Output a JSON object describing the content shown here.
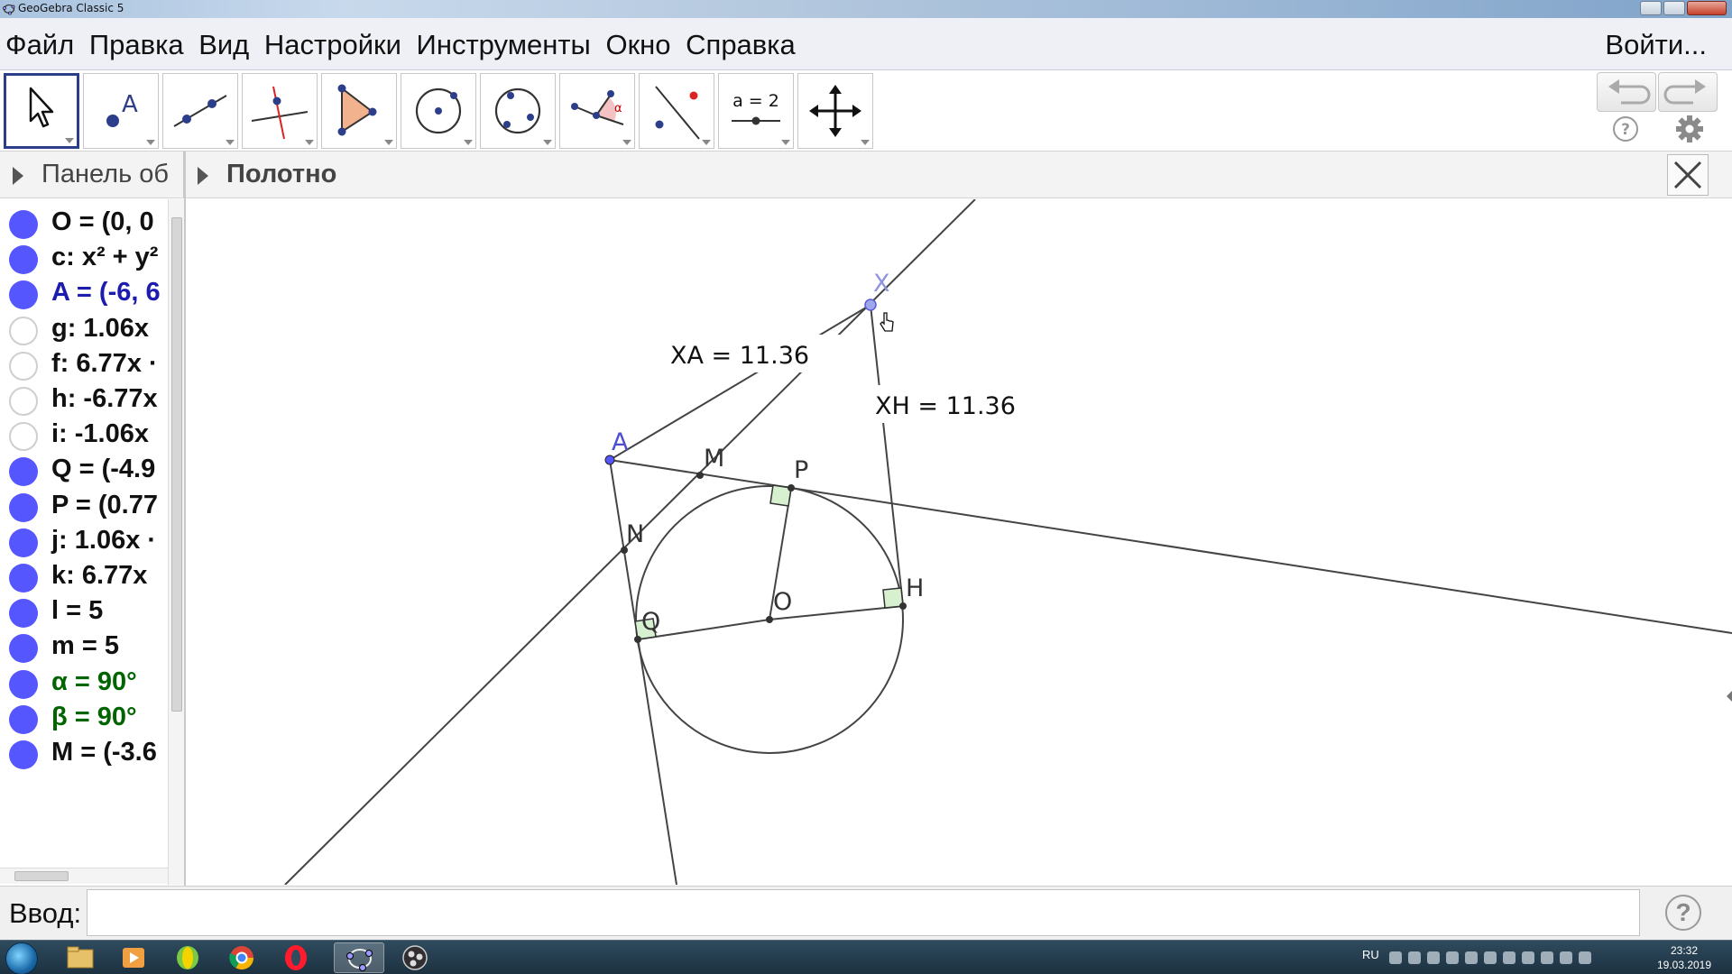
{
  "window": {
    "title": "GeoGebra Classic 5"
  },
  "menu": {
    "items": [
      {
        "label": "Файл"
      },
      {
        "label": "Правка"
      },
      {
        "label": "Вид"
      },
      {
        "label": "Настройки"
      },
      {
        "label": "Инструменты"
      },
      {
        "label": "Окно"
      },
      {
        "label": "Справка"
      }
    ],
    "login": "Войти..."
  },
  "toolbar": {
    "tools": [
      {
        "name": "move-tool"
      },
      {
        "name": "point-tool",
        "glyph": "A"
      },
      {
        "name": "line-tool"
      },
      {
        "name": "perpendicular-line-tool"
      },
      {
        "name": "polygon-tool"
      },
      {
        "name": "circle-center-point-tool"
      },
      {
        "name": "circle-three-points-tool"
      },
      {
        "name": "angle-tool",
        "glyph": "α"
      },
      {
        "name": "reflect-tool"
      },
      {
        "name": "slider-tool",
        "glyph": "a = 2"
      },
      {
        "name": "move-graphics-view-tool"
      }
    ],
    "undo": "undo-icon",
    "redo": "redo-icon",
    "help": "help-icon",
    "settings": "gear-icon"
  },
  "panels": {
    "algebra_title": "Панель об",
    "graphics_title": "Полотно"
  },
  "algebra": {
    "items": [
      {
        "text": "O = (0, 0",
        "visible": true,
        "color": "#111111"
      },
      {
        "text": "c: x² + y²",
        "visible": true,
        "color": "#111111"
      },
      {
        "text": "A = (-6, 6",
        "visible": true,
        "color": "#1c1cae"
      },
      {
        "text": "g: 1.06x",
        "visible": false,
        "color": "#111111"
      },
      {
        "text": "f: 6.77x ·",
        "visible": false,
        "color": "#111111"
      },
      {
        "text": "h: -6.77x",
        "visible": false,
        "color": "#111111"
      },
      {
        "text": "i: -1.06x",
        "visible": false,
        "color": "#111111"
      },
      {
        "text": "Q = (-4.9",
        "visible": true,
        "color": "#111111"
      },
      {
        "text": "P = (0.77",
        "visible": true,
        "color": "#111111"
      },
      {
        "text": "j: 1.06x ·",
        "visible": true,
        "color": "#111111"
      },
      {
        "text": "k: 6.77x",
        "visible": true,
        "color": "#111111"
      },
      {
        "text": "l = 5",
        "visible": true,
        "color": "#111111"
      },
      {
        "text": "m = 5",
        "visible": true,
        "color": "#111111"
      },
      {
        "text": "α = 90°",
        "visible": true,
        "color": "#006400"
      },
      {
        "text": "β = 90°",
        "visible": true,
        "color": "#006400"
      },
      {
        "text": "M = (-3.6",
        "visible": true,
        "color": "#111111"
      }
    ]
  },
  "graphics": {
    "point_labels": {
      "X": "X",
      "A": "A",
      "M": "M",
      "P": "P",
      "N": "N",
      "O": "O",
      "H": "H",
      "Q": "Q"
    },
    "measurements": {
      "xa": "XA = 11.36",
      "xh": "XH = 11.36"
    }
  },
  "input": {
    "label": "Ввод:",
    "value": "",
    "help": "?"
  },
  "taskbar": {
    "language": "RU",
    "time": "23:32",
    "date": "19.03.2019"
  },
  "colors": {
    "point_blue": "#5656ff",
    "free_point_label": "#5a5ad6",
    "angle_green": "#006400",
    "right_angle_fill": "#d6f0d0"
  }
}
